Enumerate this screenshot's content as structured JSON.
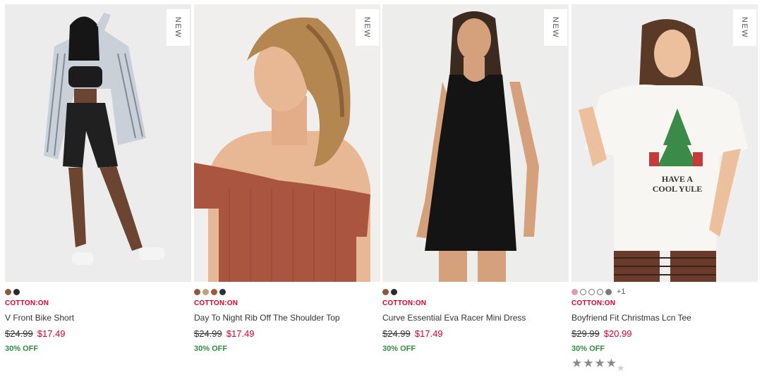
{
  "products": [
    {
      "badge": "NEW",
      "brand": "COTTON:ON",
      "name": "V Front Bike Short",
      "was_price": "$24.99",
      "now_price": "$17.49",
      "discount": "30% OFF",
      "swatches": [
        "#8b5a3c",
        "#2a2a2a"
      ]
    },
    {
      "badge": "NEW",
      "brand": "COTTON:ON",
      "name": "Day To Night Rib Off The Shoulder Top",
      "was_price": "$24.99",
      "now_price": "$17.49",
      "discount": "30% OFF",
      "swatches": [
        "#8b5a3c",
        "#b9a27c",
        "#a0583c",
        "#2b2f3a"
      ]
    },
    {
      "badge": "NEW",
      "brand": "COTTON:ON",
      "name": "Curve Essential Eva Racer Mini Dress",
      "was_price": "$24.99",
      "now_price": "$17.49",
      "discount": "30% OFF",
      "swatches": [
        "#8b5a3c",
        "#2a2a2a"
      ]
    },
    {
      "badge": "NEW",
      "brand": "COTTON:ON",
      "name": "Boyfriend Fit Christmas Lcn Tee",
      "was_price": "$29.99",
      "now_price": "$20.99",
      "discount": "30% OFF",
      "swatches": [
        "#e29ab0",
        "#ffffff",
        "#ffffff",
        "#ffffff",
        "#7a7a7a"
      ],
      "more_colors": "+1",
      "rating": 4
    }
  ]
}
